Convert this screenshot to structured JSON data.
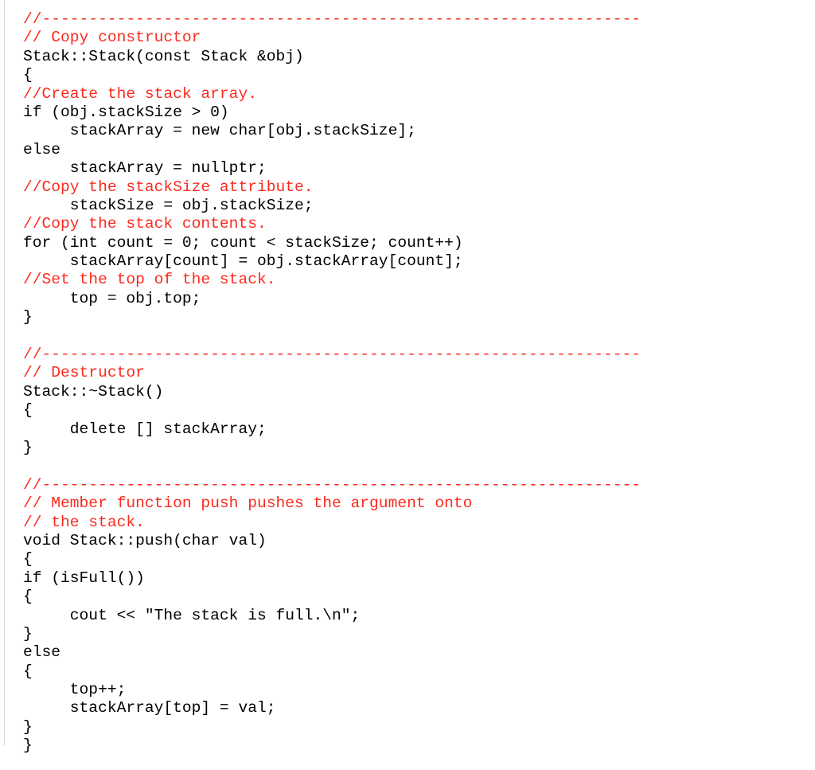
{
  "document": {
    "kind": "source-code-listing",
    "language": "C++",
    "background_color": "#ffffff",
    "code_color": "#000000",
    "comment_color": "#fa2a1e",
    "rule_color": "#d9d9d9",
    "indent": "     ",
    "separator_rule": "//----------------------------------------------------------------"
  },
  "lines": [
    {
      "text": "//----------------------------------------------------------------",
      "type": "comment"
    },
    {
      "text": "// Copy constructor",
      "type": "comment"
    },
    {
      "text": "Stack::Stack(const Stack &obj)",
      "type": "code"
    },
    {
      "text": "{",
      "type": "code"
    },
    {
      "text": "//Create the stack array.",
      "type": "comment"
    },
    {
      "text": "if (obj.stackSize > 0)",
      "type": "code"
    },
    {
      "text": "     stackArray = new char[obj.stackSize];",
      "type": "code"
    },
    {
      "text": "else",
      "type": "code"
    },
    {
      "text": "     stackArray = nullptr;",
      "type": "code"
    },
    {
      "text": "//Copy the stackSize attribute.",
      "type": "comment"
    },
    {
      "text": "     stackSize = obj.stackSize;",
      "type": "code"
    },
    {
      "text": "//Copy the stack contents.",
      "type": "comment"
    },
    {
      "text": "for (int count = 0; count < stackSize; count++)",
      "type": "code"
    },
    {
      "text": "     stackArray[count] = obj.stackArray[count];",
      "type": "code"
    },
    {
      "text": "//Set the top of the stack.",
      "type": "comment"
    },
    {
      "text": "     top = obj.top;",
      "type": "code"
    },
    {
      "text": "}",
      "type": "code"
    },
    {
      "text": "",
      "type": "blank"
    },
    {
      "text": "//----------------------------------------------------------------",
      "type": "comment"
    },
    {
      "text": "// Destructor",
      "type": "comment"
    },
    {
      "text": "Stack::~Stack()",
      "type": "code"
    },
    {
      "text": "{",
      "type": "code"
    },
    {
      "text": "     delete [] stackArray;",
      "type": "code"
    },
    {
      "text": "}",
      "type": "code"
    },
    {
      "text": "",
      "type": "blank"
    },
    {
      "text": "//----------------------------------------------------------------",
      "type": "comment"
    },
    {
      "text": "// Member function push pushes the argument onto",
      "type": "comment"
    },
    {
      "text": "// the stack.",
      "type": "comment"
    },
    {
      "text": "void Stack::push(char val)",
      "type": "code"
    },
    {
      "text": "{",
      "type": "code"
    },
    {
      "text": "if (isFull())",
      "type": "code"
    },
    {
      "text": "{",
      "type": "code"
    },
    {
      "text": "     cout << \"The stack is full.\\n\";",
      "type": "code"
    },
    {
      "text": "}",
      "type": "code"
    },
    {
      "text": "else",
      "type": "code"
    },
    {
      "text": "{",
      "type": "code"
    },
    {
      "text": "     top++;",
      "type": "code"
    },
    {
      "text": "     stackArray[top] = val;",
      "type": "code"
    },
    {
      "text": "}",
      "type": "code"
    },
    {
      "text": "}",
      "type": "code"
    }
  ]
}
